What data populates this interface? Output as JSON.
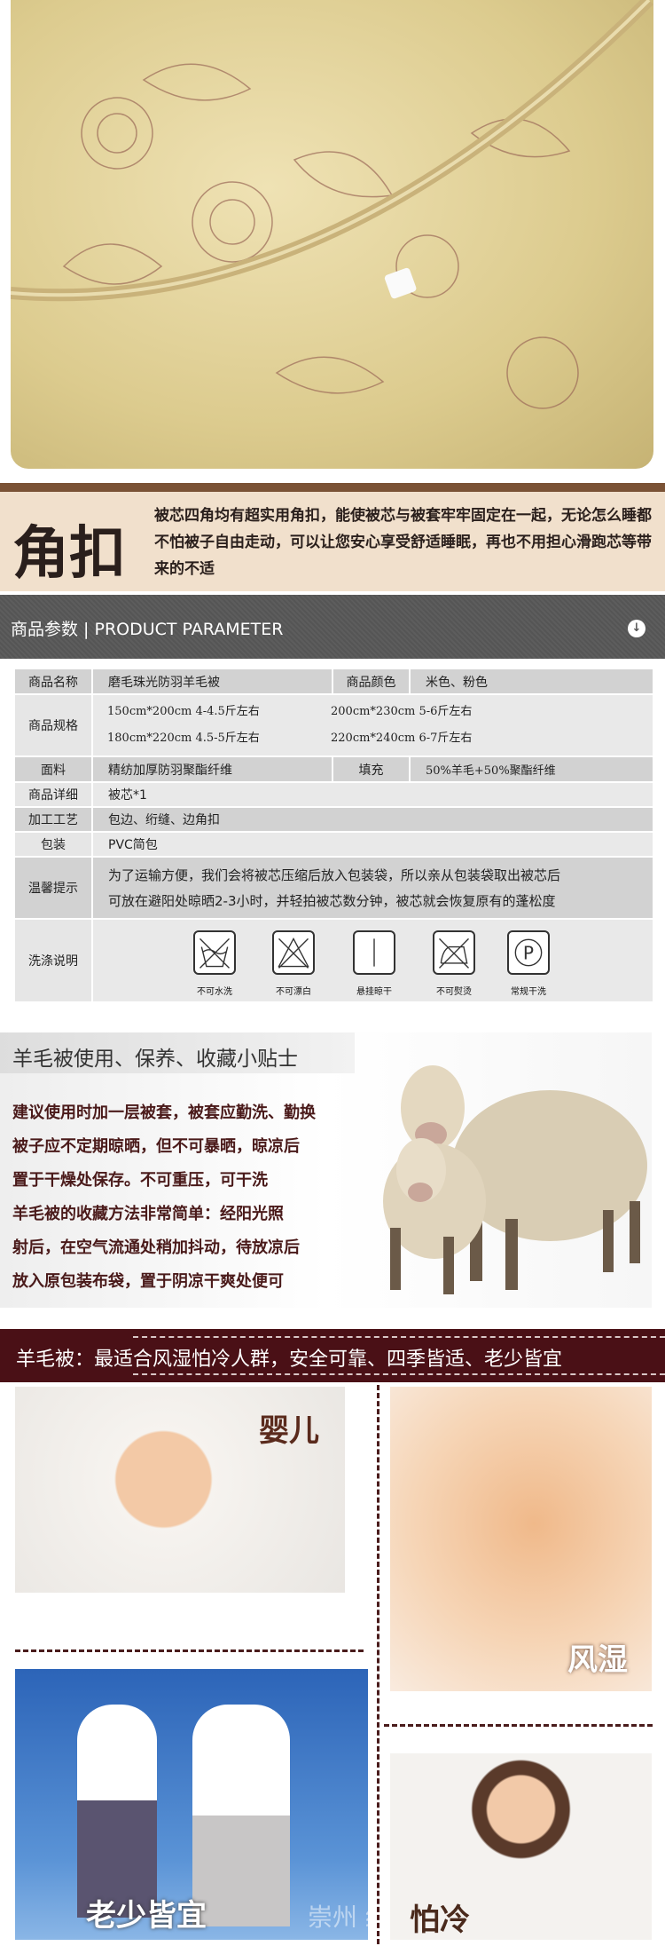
{
  "corner": {
    "title": "角扣",
    "text": "被芯四角均有超实用角扣，能使被芯与被套牢牢固定在一起，无论怎么睡都不怕被子自由走动，可以让您安心享受舒适睡眠，再也不用担心滑跑芯等带来的不适"
  },
  "param_header": {
    "title": "商品参数 | PRODUCT PARAMETER",
    "icon": "download-arrow-icon"
  },
  "table": {
    "name_label": "商品名称",
    "name": "磨毛珠光防羽羊毛被",
    "color_label": "商品颜色",
    "color": "米色、粉色",
    "spec_label": "商品规格",
    "specs": [
      "150cm*200cm 4-4.5斤左右",
      "200cm*230cm 5-6斤左右",
      "180cm*220cm 4.5-5斤左右",
      "220cm*240cm 6-7斤左右"
    ],
    "fabric_label": "面料",
    "fabric": "精纺加厚防羽聚酯纤维",
    "fill_label": "填充",
    "fill": "50%羊毛+50%聚酯纤维",
    "detail_label": "商品详细",
    "detail": "被芯*1",
    "craft_label": "加工工艺",
    "craft": "包边、绗缝、边角扣",
    "pack_label": "包装",
    "pack": "PVC简包",
    "tips_label": "温馨提示",
    "tips": [
      "为了运输方便，我们会将被芯压缩后放入包装袋，所以亲从包装袋取出被芯后",
      "可放在避阳处晾晒2-3小时，并轻拍被芯数分钟，被芯就会恢复原有的蓬松度"
    ],
    "wash_label": "洗涤说明",
    "wash": [
      {
        "icon": "no-wash-icon",
        "label": "不可水洗"
      },
      {
        "icon": "no-bleach-icon",
        "label": "不可漂白"
      },
      {
        "icon": "hang-dry-icon",
        "label": "悬挂晾干"
      },
      {
        "icon": "no-iron-icon",
        "label": "不可熨烫"
      },
      {
        "icon": "dry-clean-p-icon",
        "label": "常规干洗"
      }
    ]
  },
  "tips_section": {
    "title": "羊毛被使用、保养、收藏小贴士",
    "lines": [
      "建议使用时加一层被套，被套应勤洗、勤换",
      "被子应不定期晾晒，但不可暴晒，晾凉后",
      "置于干燥处保存。不可重压，可干洗",
      "羊毛被的收藏方法非常简单：经阳光照",
      "射后，在空气流通处稍加抖动，待放凉后",
      "放入原包装布袋，置于阴凉干爽处便可"
    ]
  },
  "banner": {
    "text": "羊毛被：最适合风湿怕冷人群，安全可靠、四季皆适、老少皆宜"
  },
  "photos": {
    "baby": "婴儿",
    "rheumatism": "风湿",
    "all_ages": "老少皆宜",
    "cold": "怕冷",
    "watermark": "崇州    纺织品"
  },
  "colors": {
    "brown": "#7a5235",
    "beige": "#f1e0cc",
    "maroon": "#4a1016",
    "header_grey": "#555555"
  }
}
